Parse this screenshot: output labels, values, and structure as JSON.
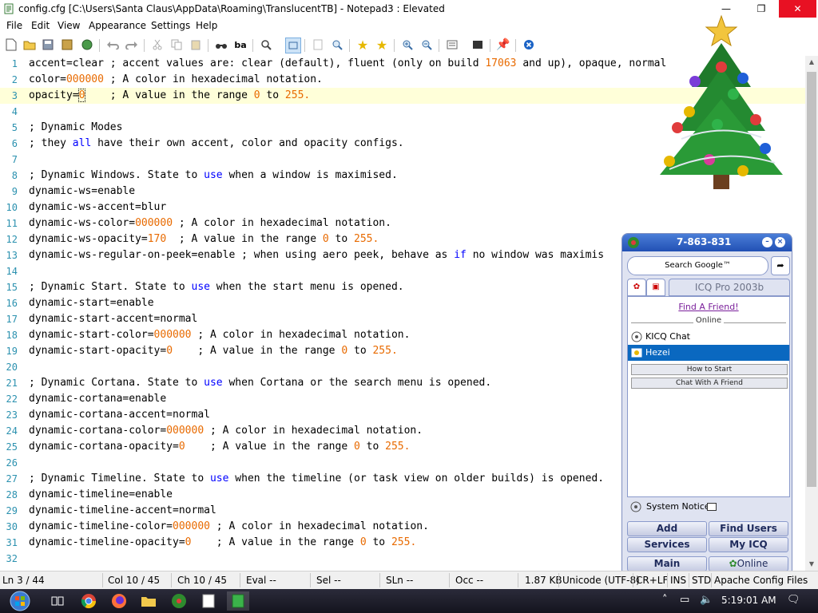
{
  "window": {
    "title": "config.cfg [C:\\Users\\Santa Claus\\AppData\\Roaming\\TranslucentTB] - Notepad3 : Elevated",
    "min_glyph": "—",
    "max_glyph": "❐",
    "close_glyph": "✕"
  },
  "menu": [
    "File",
    "Edit",
    "View",
    "Appearance",
    "Settings",
    "Help"
  ],
  "toolbar_icons": [
    "new-icon",
    "open-icon",
    "save-icon",
    "save-as-icon",
    "browse-icon",
    "undo-icon",
    "redo-icon",
    "cut-icon",
    "copy-icon",
    "paste-icon",
    "find-icon",
    "replace-icon",
    "zoom-icon",
    "wordwrap-icon",
    "select-icon",
    "find-text-icon",
    "favorite-icon",
    "add-favorite-icon",
    "zoom-in-icon",
    "zoom-out-icon",
    "scheme-icon",
    "view-icon",
    "pin-icon",
    "exit-icon"
  ],
  "editor": {
    "lines": [
      {
        "n": "1",
        "tokens": [
          [
            "t",
            "accent=clear ; accent values are: clear (default), fluent (only on build "
          ],
          [
            "n",
            "17063"
          ],
          [
            "t",
            " and up), opaque, normal"
          ]
        ]
      },
      {
        "n": "2",
        "tokens": [
          [
            "t",
            "color="
          ],
          [
            "n",
            "000000"
          ],
          [
            "t",
            " ; A color in hexadecimal notation."
          ]
        ]
      },
      {
        "n": "3",
        "tokens": [
          [
            "t",
            "opacity="
          ],
          [
            "c",
            "0"
          ],
          [
            "t",
            "    ; A value in the range "
          ],
          [
            "n",
            "0"
          ],
          [
            "t",
            " to "
          ],
          [
            "n",
            "255."
          ]
        ]
      },
      {
        "n": "4",
        "tokens": []
      },
      {
        "n": "5",
        "tokens": [
          [
            "t",
            "; Dynamic Modes"
          ]
        ]
      },
      {
        "n": "6",
        "tokens": [
          [
            "t",
            "; they "
          ],
          [
            "k",
            "all"
          ],
          [
            "t",
            " have their own accent, color and opacity configs."
          ]
        ]
      },
      {
        "n": "7",
        "tokens": []
      },
      {
        "n": "8",
        "tokens": [
          [
            "t",
            "; Dynamic Windows. State to "
          ],
          [
            "k",
            "use"
          ],
          [
            "t",
            " when a window is maximised."
          ]
        ]
      },
      {
        "n": "9",
        "tokens": [
          [
            "t",
            "dynamic-ws=enable"
          ]
        ]
      },
      {
        "n": "10",
        "tokens": [
          [
            "t",
            "dynamic-ws-accent=blur"
          ]
        ]
      },
      {
        "n": "11",
        "tokens": [
          [
            "t",
            "dynamic-ws-color="
          ],
          [
            "n",
            "000000"
          ],
          [
            "t",
            " ; A color in hexadecimal notation."
          ]
        ]
      },
      {
        "n": "12",
        "tokens": [
          [
            "t",
            "dynamic-ws-opacity="
          ],
          [
            "n",
            "170"
          ],
          [
            "t",
            "  ; A value in the range "
          ],
          [
            "n",
            "0"
          ],
          [
            "t",
            " to "
          ],
          [
            "n",
            "255."
          ]
        ]
      },
      {
        "n": "13",
        "tokens": [
          [
            "t",
            "dynamic-ws-regular-on-peek=enable ; when using aero peek, behave as "
          ],
          [
            "k",
            "if"
          ],
          [
            "t",
            " no window was maximis"
          ]
        ]
      },
      {
        "n": "14",
        "tokens": []
      },
      {
        "n": "15",
        "tokens": [
          [
            "t",
            "; Dynamic Start. State to "
          ],
          [
            "k",
            "use"
          ],
          [
            "t",
            " when the start menu is opened."
          ]
        ]
      },
      {
        "n": "16",
        "tokens": [
          [
            "t",
            "dynamic-start=enable"
          ]
        ]
      },
      {
        "n": "17",
        "tokens": [
          [
            "t",
            "dynamic-start-accent=normal"
          ]
        ]
      },
      {
        "n": "18",
        "tokens": [
          [
            "t",
            "dynamic-start-color="
          ],
          [
            "n",
            "000000"
          ],
          [
            "t",
            " ; A color in hexadecimal notation."
          ]
        ]
      },
      {
        "n": "19",
        "tokens": [
          [
            "t",
            "dynamic-start-opacity="
          ],
          [
            "n",
            "0"
          ],
          [
            "t",
            "    ; A value in the range "
          ],
          [
            "n",
            "0"
          ],
          [
            "t",
            " to "
          ],
          [
            "n",
            "255."
          ]
        ]
      },
      {
        "n": "20",
        "tokens": []
      },
      {
        "n": "21",
        "tokens": [
          [
            "t",
            "; Dynamic Cortana. State to "
          ],
          [
            "k",
            "use"
          ],
          [
            "t",
            " when Cortana or the search menu is opened."
          ]
        ]
      },
      {
        "n": "22",
        "tokens": [
          [
            "t",
            "dynamic-cortana=enable"
          ]
        ]
      },
      {
        "n": "23",
        "tokens": [
          [
            "t",
            "dynamic-cortana-accent=normal"
          ]
        ]
      },
      {
        "n": "24",
        "tokens": [
          [
            "t",
            "dynamic-cortana-color="
          ],
          [
            "n",
            "000000"
          ],
          [
            "t",
            " ; A color in hexadecimal notation."
          ]
        ]
      },
      {
        "n": "25",
        "tokens": [
          [
            "t",
            "dynamic-cortana-opacity="
          ],
          [
            "n",
            "0"
          ],
          [
            "t",
            "    ; A value in the range "
          ],
          [
            "n",
            "0"
          ],
          [
            "t",
            " to "
          ],
          [
            "n",
            "255."
          ]
        ]
      },
      {
        "n": "26",
        "tokens": []
      },
      {
        "n": "27",
        "tokens": [
          [
            "t",
            "; Dynamic Timeline. State to "
          ],
          [
            "k",
            "use"
          ],
          [
            "t",
            " when the timeline (or task view on older builds) is opened."
          ]
        ]
      },
      {
        "n": "28",
        "tokens": [
          [
            "t",
            "dynamic-timeline=enable"
          ]
        ]
      },
      {
        "n": "29",
        "tokens": [
          [
            "t",
            "dynamic-timeline-accent=normal"
          ]
        ]
      },
      {
        "n": "30",
        "tokens": [
          [
            "t",
            "dynamic-timeline-color="
          ],
          [
            "n",
            "000000"
          ],
          [
            "t",
            " ; A color in hexadecimal notation."
          ]
        ]
      },
      {
        "n": "31",
        "tokens": [
          [
            "t",
            "dynamic-timeline-opacity="
          ],
          [
            "n",
            "0"
          ],
          [
            "t",
            "    ; A value in the range "
          ],
          [
            "n",
            "0"
          ],
          [
            "t",
            " to "
          ],
          [
            "n",
            "255."
          ]
        ]
      },
      {
        "n": "32",
        "tokens": []
      }
    ],
    "current_line": 3
  },
  "status": {
    "ln": "Ln 3 / 44",
    "col": "Col 10 / 45",
    "ch": "Ch 10 / 45",
    "eval": "Eval --",
    "sel": "Sel --",
    "sln": "SLn --",
    "occ": "Occ --",
    "size": "1.87 KB",
    "encoding": "Unicode (UTF-8)",
    "eol": "CR+LF",
    "ins": "INS",
    "std": "STD",
    "lexer": "Apache Config Files"
  },
  "taskbar": {
    "apps": [
      "start-orb-icon",
      "task-view-icon",
      "chrome-icon",
      "firefox-icon",
      "file-explorer-icon",
      "icq-icon",
      "notepad-icon",
      "notepad3-icon"
    ],
    "clock": "5:19:01 AM"
  },
  "icq": {
    "uin": "7-863-831",
    "search_label": "Search Google™",
    "title": "ICQ Pro 2003b",
    "find_friend": "Find A Friend!",
    "online_header": "Online",
    "contacts": [
      {
        "name": "KICQ Chat",
        "selected": false
      },
      {
        "name": "Hezei",
        "selected": true
      }
    ],
    "groups": [
      "How to Start",
      "Chat With A Friend"
    ],
    "system_notice": "System Notice",
    "buttons": {
      "add": "Add",
      "find_users": "Find Users",
      "services": "Services",
      "my_icq": "My ICQ",
      "main": "Main",
      "online": "Online"
    }
  },
  "colors": {
    "number": "#e86a00",
    "keyword": "#0000ff",
    "current_line": "#ffffd9",
    "line_number": "#2b91af",
    "close_button": "#e81123"
  }
}
